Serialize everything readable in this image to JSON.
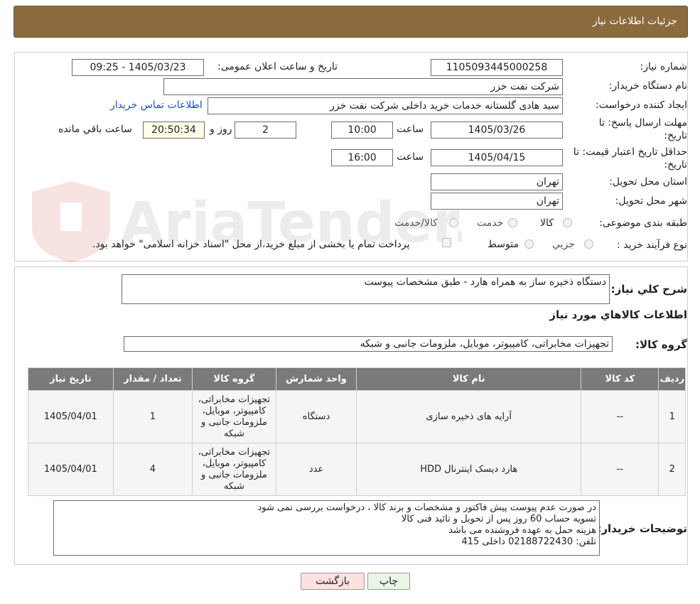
{
  "header": {
    "title": "جزئیات اطلاعات نیاز"
  },
  "labels": {
    "need_number": "شماره نیاز:",
    "announce_datetime": "تاریخ و ساعت اعلان عمومی:",
    "buyer_org": "نام دستگاه خریدار:",
    "creator": "ایجاد کننده درخواست:",
    "reply_deadline_line1": "مهلت ارسال پاسخ: تا",
    "reply_deadline_line2": "تاریخ:",
    "time_word": "ساعت",
    "day_and": "روز و",
    "remaining": "ساعت باقي مانده",
    "price_validity_line1": "حداقل تاریخ اعتبار قیمت: تا",
    "price_validity_line2": "تاریخ:",
    "province": "استان محل تحویل:",
    "city": "شهر محل تحویل:",
    "category": "طبقه بندی موضوعی:",
    "purchase_type": "نوع فرآیند خرید :",
    "general_desc": "شرح کلي نیاز:",
    "items_info": "اطلاعات کالاهاي مورد نیاز",
    "goods_group": "گروه کالا:",
    "buyer_notes": "توضیحات خریدار:"
  },
  "values": {
    "need_number": "1105093445000258",
    "announce_datetime": "1405/03/23 - 09:25",
    "buyer_org": "شرکت نفت خزر",
    "creator": "سید هادی گلستانه خدمات خرید داخلی شرکت نفت خزر",
    "contact_link": "اطلاعات تماس خریدار",
    "reply_date": "1405/03/26",
    "reply_time": "10:00",
    "reply_days": "2",
    "reply_remaining": "20:50:34",
    "price_date": "1405/04/15",
    "price_time": "16:00",
    "province": "تهران",
    "city": "تهران",
    "general_desc": "دستگاه ذخیره ساز به همراه هارد - طبق مشخصات پیوست",
    "goods_group": "تجهیزات مخابراتی، کامپیوتر، موبایل، ملزومات جانبی و شبکه",
    "buyer_notes": "در صورت عدم پیوست پیش فاکتور و مشخصات و برند کالا ، درخواست بررسی نمی شود\nتسویه حساب 60 روز پس از تحویل و تائید فنی کالا\nهزینه حمل به عهده فروشنده می باشد\nتلفن: 02188722430 داخلی 415"
  },
  "category_options": [
    "کالا",
    "خدمت",
    "کالا/خدمت"
  ],
  "purchase_options": [
    "جزیي",
    "متوسط"
  ],
  "purchase_note": "پرداخت تمام یا بخشی از مبلغ خرید،از محل \"اسناد خزانه اسلامی\" خواهد بود.",
  "table": {
    "headers": [
      "ردیف",
      "کد کالا",
      "نام کالا",
      "واحد شمارش",
      "گروه کالا",
      "تعداد / مقدار",
      "تاریخ نیاز"
    ],
    "rows": [
      [
        "1",
        "--",
        "آرایه های ذخیره سازی",
        "دستگاه",
        "تجهیزات مخابراتی، کامپیوتر، موبایل، ملزومات جانبی و شبکه",
        "1",
        "1405/04/01"
      ],
      [
        "2",
        "--",
        "هارد دیسک اینترنال HDD",
        "عدد",
        "تجهیزات مخابراتی، کامپیوتر، موبایل، ملزومات جانبی و شبکه",
        "4",
        "1405/04/01"
      ]
    ]
  },
  "buttons": {
    "print": "چاپ",
    "back": "بازگشت"
  },
  "colors": {
    "header": "#8b6a3d",
    "table_header": "#7a7a7a",
    "link": "#1b4fbf",
    "back_button": "#fde0e0",
    "print_button": "#e8f7e4"
  }
}
